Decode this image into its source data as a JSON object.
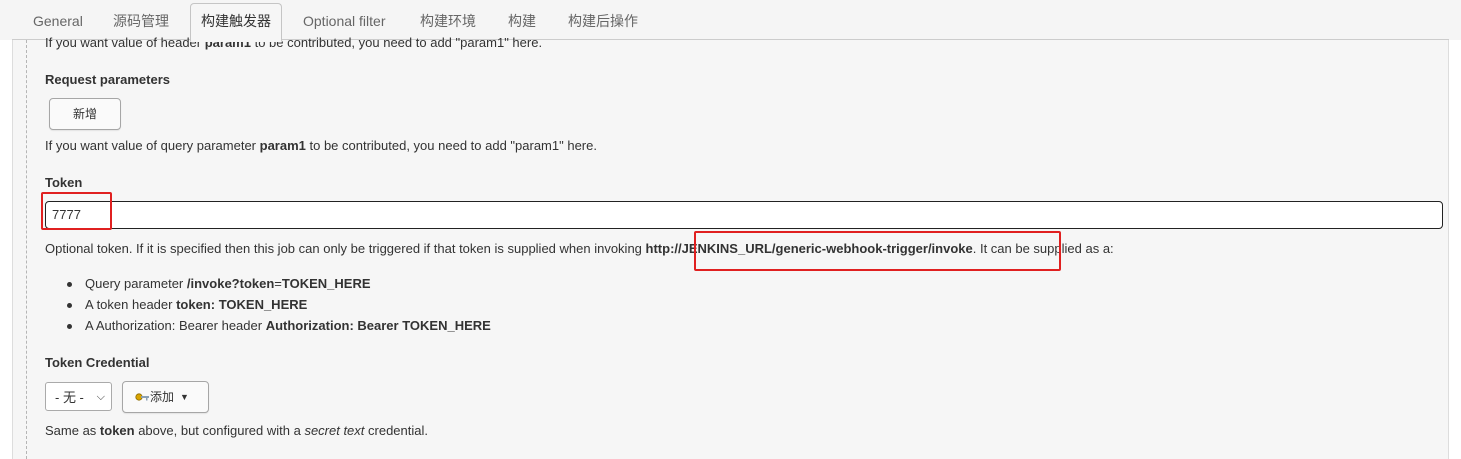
{
  "tabs": [
    {
      "label": "General"
    },
    {
      "label": "源码管理"
    },
    {
      "label": "构建触发器"
    },
    {
      "label": "Optional filter"
    },
    {
      "label": "构建环境"
    },
    {
      "label": "构建"
    },
    {
      "label": "构建后操作"
    }
  ],
  "active_tab": "构建触发器",
  "header_param": {
    "prefix": "If you want value of header ",
    "name": "param1",
    "suffix": " to be contributed, you need to add \"param1\" here."
  },
  "request_parameters": {
    "label": "Request parameters",
    "add_button": "新增",
    "help_prefix": "If you want value of query parameter ",
    "help_name": "param1",
    "help_suffix": " to be contributed, you need to add \"param1\" here."
  },
  "token": {
    "label": "Token",
    "value": "7777",
    "help_prefix": "Optional token. If it is specified then this job can only be triggered if that token is supplied when invoking ",
    "help_url": "http://JENKINS_URL/generic-webhook-trigger/invoke",
    "help_suffix": ". It can be supplied as a:",
    "options": [
      {
        "prefix": "Query parameter ",
        "bold_a": "/invoke?token",
        "mid": "=",
        "bold_b": "TOKEN_HERE"
      },
      {
        "prefix": "A token header ",
        "bold_a": "token: TOKEN_HERE",
        "mid": "",
        "bold_b": ""
      },
      {
        "prefix": "A Authorization: Bearer header ",
        "bold_a": "Authorization: Bearer TOKEN_HERE",
        "mid": "",
        "bold_b": ""
      }
    ]
  },
  "token_credential": {
    "label": "Token Credential",
    "selected": "- 无 -",
    "add_button": "添加",
    "help_prefix": "Same as ",
    "help_bold": "token",
    "help_mid": " above, but configured with a ",
    "help_italic": "secret text",
    "help_suffix": " credential."
  },
  "colors": {
    "highlight": "#e02020",
    "panel_bg": "#f6f6f6"
  },
  "icons": {
    "add_credential": "key-icon",
    "dropdown": "caret-down-icon"
  }
}
